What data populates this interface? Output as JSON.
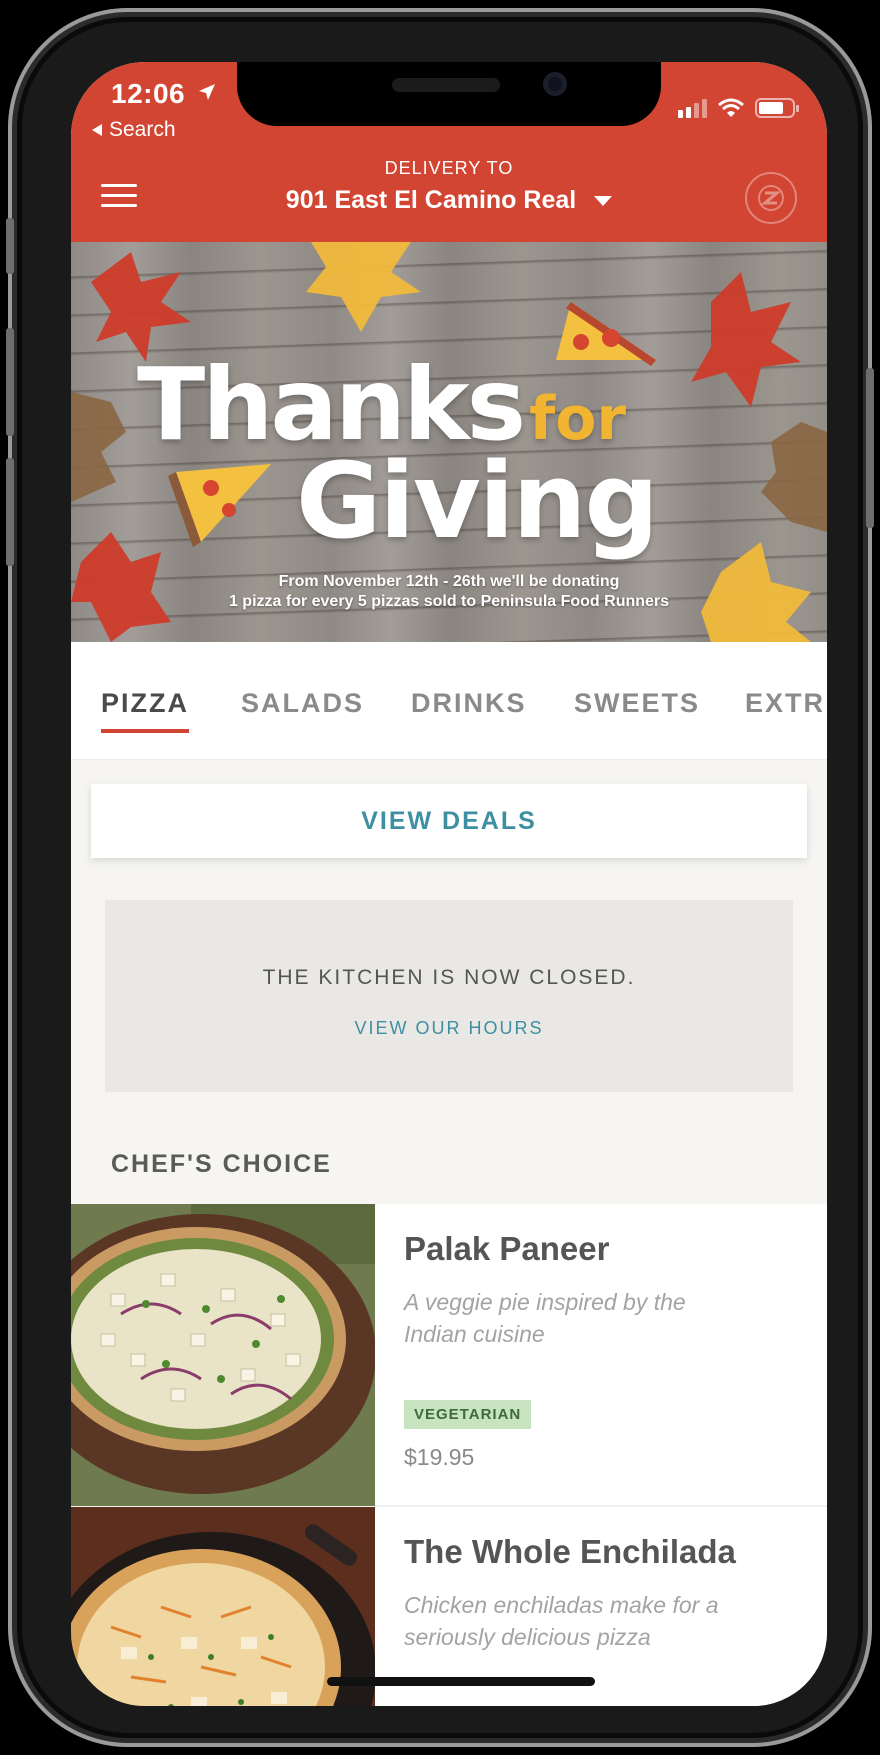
{
  "status_bar": {
    "time": "12:06",
    "back_label": "Search"
  },
  "header": {
    "delivery_label": "DELIVERY TO",
    "address": "901 East El Camino Real",
    "brand_color": "#d24533"
  },
  "banner": {
    "title_line1": "Thanks",
    "title_for": "for",
    "title_line2": "Giving",
    "caption_line1": "From November 12th - 26th we'll be donating",
    "caption_line2": "1 pizza for every 5 pizzas sold to Peninsula Food Runners"
  },
  "tabs": [
    {
      "label": "PIZZA",
      "active": true
    },
    {
      "label": "SALADS",
      "active": false
    },
    {
      "label": "DRINKS",
      "active": false
    },
    {
      "label": "SWEETS",
      "active": false
    },
    {
      "label": "EXTR",
      "active": false
    }
  ],
  "deals": {
    "label": "VIEW DEALS"
  },
  "kitchen": {
    "status": "THE KITCHEN IS NOW CLOSED.",
    "link": "VIEW OUR HOURS"
  },
  "section": {
    "title": "CHEF'S CHOICE"
  },
  "menu": [
    {
      "name": "Palak Paneer",
      "description": "A veggie pie inspired by the Indian cuisine",
      "tag": "VEGETARIAN",
      "price": "$19.95"
    },
    {
      "name": "The Whole Enchilada",
      "description": "Chicken enchiladas make for a seriously delicious pizza"
    }
  ],
  "colors": {
    "accent": "#3f8fa3",
    "tag_bg": "#c7e3c0"
  }
}
